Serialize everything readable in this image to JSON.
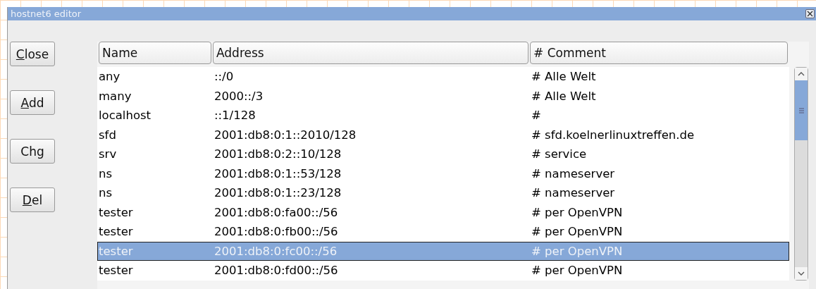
{
  "window": {
    "title": "hostnet6 editor"
  },
  "buttons": [
    {
      "key": "C",
      "after": "lose"
    },
    {
      "key": "A",
      "after": "dd"
    },
    {
      "before": "Ch",
      "key": "g"
    },
    {
      "key": "D",
      "after": "el"
    }
  ],
  "table": {
    "columns": [
      "Name",
      "Address",
      "# Comment"
    ],
    "rows": [
      {
        "cells": [
          "any",
          "::/0",
          "# Alle Welt"
        ],
        "selected": false
      },
      {
        "cells": [
          "many",
          "2000::/3",
          "# Alle Welt"
        ],
        "selected": false
      },
      {
        "cells": [
          "localhost",
          "::1/128",
          "#"
        ],
        "selected": false
      },
      {
        "cells": [
          "sfd",
          "2001:db8:0:1::2010/128",
          "# sfd.koelnerlinuxtreffen.de"
        ],
        "selected": false
      },
      {
        "cells": [
          "srv",
          "2001:db8:0:2::10/128",
          "# service"
        ],
        "selected": false
      },
      {
        "cells": [
          "ns",
          "2001:db8:0:1::53/128",
          "# nameserver"
        ],
        "selected": false
      },
      {
        "cells": [
          "ns",
          "2001:db8:0:1::23/128",
          "# nameserver"
        ],
        "selected": false
      },
      {
        "cells": [
          "tester",
          "2001:db8:0:fa00::/56",
          "# per OpenVPN"
        ],
        "selected": false
      },
      {
        "cells": [
          "tester",
          "2001:db8:0:fb00::/56",
          "# per OpenVPN"
        ],
        "selected": false
      },
      {
        "cells": [
          "tester",
          "2001:db8:0:fc00::/56",
          "# per OpenVPN"
        ],
        "selected": true
      },
      {
        "cells": [
          "tester",
          "2001:db8:0:fd00::/56",
          "# per OpenVPN"
        ],
        "selected": false
      }
    ]
  }
}
